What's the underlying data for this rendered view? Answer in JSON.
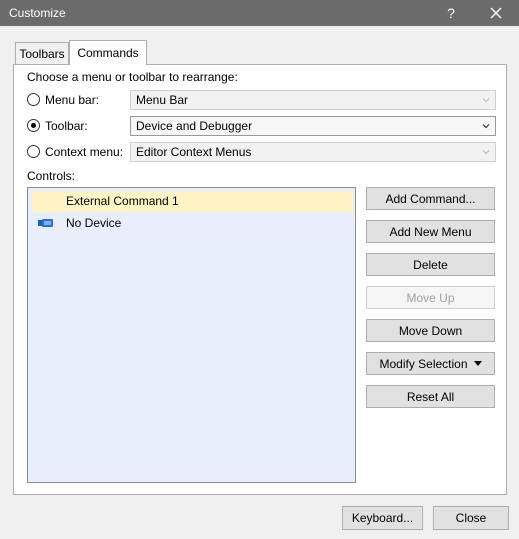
{
  "window": {
    "title": "Customize",
    "help": "?"
  },
  "tabs": [
    {
      "label": "Toolbars"
    },
    {
      "label": "Commands"
    }
  ],
  "chooser": {
    "prompt": "Choose a menu or toolbar to rearrange:",
    "options": [
      {
        "label": "Menu bar:",
        "selected": false,
        "value": "Menu Bar",
        "enabled": false
      },
      {
        "label": "Toolbar:",
        "selected": true,
        "value": "Device and Debugger",
        "enabled": true
      },
      {
        "label": "Context menu:",
        "selected": false,
        "value": "Editor Context Menus",
        "enabled": false
      }
    ]
  },
  "controls": {
    "label": "Controls:",
    "items": [
      {
        "label": "External Command 1",
        "selected": true,
        "icon": "none"
      },
      {
        "label": "No Device",
        "selected": false,
        "icon": "device-icon"
      }
    ]
  },
  "actions": {
    "add_command": "Add Command...",
    "add_new_menu": "Add New Menu",
    "delete": "Delete",
    "move_up": "Move Up",
    "move_down": "Move Down",
    "modify_selection": "Modify Selection",
    "reset_all": "Reset All"
  },
  "footer": {
    "keyboard": "Keyboard...",
    "close": "Close"
  },
  "colors": {
    "titlebar": "#6b6b6b",
    "list_background": "#e8eefc",
    "selected_item": "#fff3c4",
    "device_icon": "#1f5fbf"
  }
}
